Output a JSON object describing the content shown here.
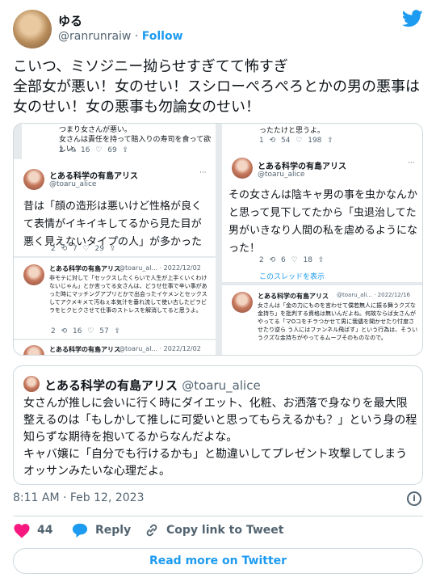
{
  "author": {
    "display_name": "ゆる",
    "handle": "@ranrunraiw",
    "separator": "·",
    "follow_label": "Follow"
  },
  "tweet": {
    "text": "こいつ、ミソジニー拗らせすぎてて怖すぎ\n全部女が悪い！女のせい！スシローぺろぺろとかの男の悪事は女のせい！女の悪事も勿論女のせい！"
  },
  "embedded_image": {
    "top_left": {
      "text": "つまり女さんが悪い。\n女さんは責任を持って賠入りの寿司を食って欲しい。",
      "actions": "2   ⟲ 16   ♡ 69   ⇪"
    },
    "top_right": {
      "text": "ったたけと思うよ。",
      "actions": "1   ⟲ 54   ♡ 198   ⇪"
    },
    "mid_left": {
      "name": "とある科学の有島アリス",
      "handle": "@toaru_alice",
      "text": "昔は「顔の造形は悪いけど性格が良くて表情がイキイキしてるから見た目が悪く見えないタイプの人」が多かったけど、これこ",
      "actions": "2   ⟲ 7   ♡ 29   ⇪"
    },
    "mid_right": {
      "name": "とある科学の有島アリス",
      "handle": "@toaru_alice",
      "text": "その女さんは陰キャ男の事を虫かなんかと思って見下してたから「虫退治してた男がいきなり人間の私を虐めるようになった！",
      "actions": "2   ⟲ 6   ♡ 18   ⇪",
      "thread_link": "このスレッドを表示"
    },
    "bottom_left": {
      "name": "とある科学の有島アリス",
      "meta": "@toaru_al... · 2022/12/02",
      "text": "非モテに対して「セックスしたくらいで人生が上手くいくわけないじゃん」とか言ってる女さんは、どうせ仕事で辛い事があった時にマッチングアプリとかで出会ったイケメンとセックスしてアクメキメて汚ねぇ本気汁を垂れ流して使い古したビラビラをヒクヒクさせて仕事のストレスを解消してると思うよ。",
      "actions": "2   ⟲ 16   ♡ 57   ⇪"
    },
    "bottom_left_2": {
      "name": "とある科学の有島アリス",
      "meta": "@toaru_al... · 2022/12/02"
    },
    "bottom_right": {
      "name": "とある科学の有島アリス",
      "meta": "@toaru_ali... · 2022/12/16",
      "text": "女さんは「金の力にものを言わせて僕若無人に振る舞うクズな金持ち」を批判する資格は無いんだよね。何故ならば女さんがやってる「マOコをチラつかせて男に我儘を聞かせたり忖度させたり逆ら う人にはファンネル飛ばす」という行為は、そういうクズな金持ちがやってるムーブそのものなので。"
    }
  },
  "quoted_tweet": {
    "name": "とある科学の有島アリス",
    "handle": "@toaru_alice",
    "text": "女さんが推しに会いに行く時にダイエット、化粧、お洒落で身なりを最大限整えるのは「もしかして推しに可愛いと思ってもらえるかも？」という身の程知らずな期待を抱いてるからなんだよな。\nキャバ嬢に「自分でも行けるかも」と勘違いしてプレゼント攻撃してしまうオッサンみたいな心理だよ。"
  },
  "timestamp": "8:11 AM · Feb 12, 2023",
  "actions": {
    "like_count": "44",
    "reply_label": "Reply",
    "copy_link_label": "Copy link to Tweet"
  },
  "read_more_label": "Read more on Twitter",
  "colors": {
    "twitter_blue": "#1d9bf0",
    "like_red": "#f91880",
    "muted": "#536471",
    "border": "#cfd9de"
  }
}
